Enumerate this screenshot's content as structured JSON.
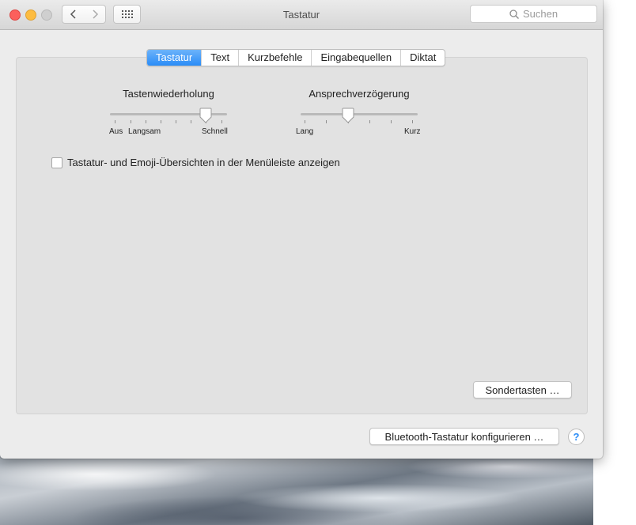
{
  "window": {
    "title": "Tastatur",
    "search_placeholder": "Suchen"
  },
  "tabs": [
    {
      "label": "Tastatur",
      "active": true
    },
    {
      "label": "Text",
      "active": false
    },
    {
      "label": "Kurzbefehle",
      "active": false
    },
    {
      "label": "Eingabequellen",
      "active": false
    },
    {
      "label": "Diktat",
      "active": false
    }
  ],
  "key_repeat": {
    "title": "Tastenwiederholung",
    "labels": {
      "off": "Aus",
      "slow": "Langsam",
      "fast": "Schnell"
    },
    "value_fraction": 0.83
  },
  "delay_until_repeat": {
    "title": "Ansprechverzögerung",
    "labels": {
      "long": "Lang",
      "short": "Kurz"
    },
    "value_fraction": 0.4
  },
  "show_viewers_checkbox": {
    "label": "Tastatur- und Emoji-Übersichten in der Menüleiste anzeigen",
    "checked": false
  },
  "buttons": {
    "modifier_keys": "Sondertasten …",
    "bluetooth_setup": "Bluetooth-Tastatur konfigurieren …",
    "help": "?"
  },
  "colors": {
    "accent": "#2a8cf7",
    "close": "#fc605c",
    "minimize": "#fdbc40",
    "zoom": "#cfcfcf"
  }
}
